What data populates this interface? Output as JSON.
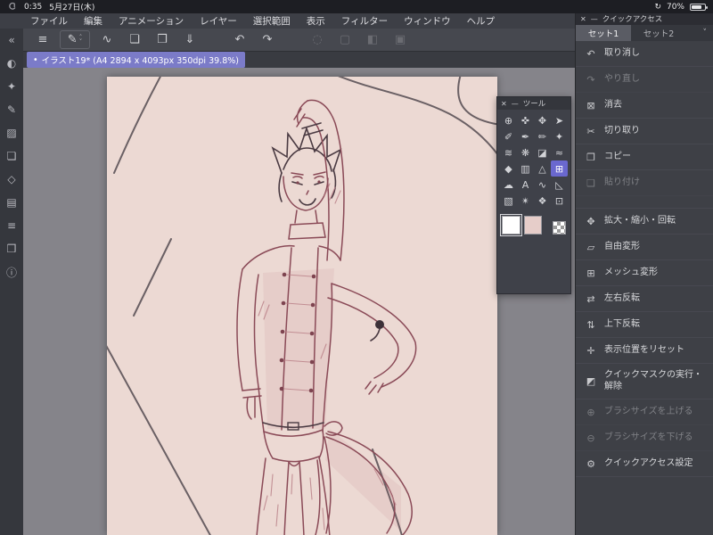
{
  "colors": {
    "app_bg": "#3d3f46",
    "canvas_surround": "#85848a",
    "paper": "#ecd9d3",
    "doc_tab_highlight": "#7b7bc8",
    "selected_tool": "#6a68cf",
    "active_toolbar_button": "#4d6096"
  },
  "status_bar": {
    "time": "0:35",
    "date": "5月27日(木)",
    "orientation_icon": "↻",
    "battery_percent": "70%"
  },
  "menu_bar": {
    "items": [
      "ファイル",
      "編集",
      "アニメーション",
      "レイヤー",
      "選択範囲",
      "表示",
      "フィルター",
      "ウィンドウ",
      "ヘルプ"
    ]
  },
  "toolbar": {
    "chevron_up": "˄",
    "chevron_down": "˅",
    "buttons": [
      {
        "name": "main-menu",
        "glyph": "≡"
      },
      {
        "name": "tool-property",
        "glyph": "✎"
      },
      {
        "name": "curve-tool",
        "glyph": "∿"
      },
      {
        "name": "new-canvas",
        "glyph": "❏"
      },
      {
        "name": "open-file",
        "glyph": "❒"
      },
      {
        "name": "export",
        "glyph": "⇓"
      },
      {
        "name": "undo",
        "glyph": "↶"
      },
      {
        "name": "redo",
        "glyph": "↷"
      },
      {
        "name": "selection-launcher",
        "glyph": "◌",
        "disabled": true
      },
      {
        "name": "deselect",
        "glyph": "▢",
        "disabled": true
      },
      {
        "name": "invert-selection",
        "glyph": "◧",
        "disabled": true
      },
      {
        "name": "fill-selection",
        "glyph": "▣",
        "disabled": true
      },
      {
        "name": "pen-mode",
        "glyph": "✒",
        "active": true
      },
      {
        "name": "brush-mode",
        "glyph": "✐",
        "active": true
      },
      {
        "name": "edit-pencil",
        "glyph": "✏"
      }
    ]
  },
  "doc_bar": {
    "indicator": "•",
    "tab_label": "イラスト19* (A4 2894 x 4093px 350dpi 39.8%)",
    "highlight": "#7b7bc8"
  },
  "sidebar": {
    "icons": [
      {
        "name": "collapse",
        "glyph": "«"
      },
      {
        "name": "color-circle",
        "glyph": "◐"
      },
      {
        "name": "color-set",
        "glyph": "✦"
      },
      {
        "name": "pen-settings",
        "glyph": "✎"
      },
      {
        "name": "material",
        "glyph": "▨"
      },
      {
        "name": "layers",
        "glyph": "❏"
      },
      {
        "name": "3d-material",
        "glyph": "◇"
      },
      {
        "name": "navigator",
        "glyph": "▤"
      },
      {
        "name": "item-list",
        "glyph": "≡"
      },
      {
        "name": "subview",
        "glyph": "❒"
      },
      {
        "name": "information",
        "glyph": "ⓘ"
      }
    ]
  },
  "tool_palette": {
    "close_glyph": "✕",
    "minimize_glyph": "—",
    "title": "ツール",
    "selected_color": "#6a68cf",
    "tools": [
      {
        "name": "zoom",
        "glyph": "⊕"
      },
      {
        "name": "hand",
        "glyph": "✜"
      },
      {
        "name": "move",
        "glyph": "✥"
      },
      {
        "name": "object",
        "glyph": "➤"
      },
      {
        "name": "eyedropper",
        "glyph": "✐"
      },
      {
        "name": "pen",
        "glyph": "✒"
      },
      {
        "name": "pencil",
        "glyph": "✏"
      },
      {
        "name": "brush",
        "glyph": "✦"
      },
      {
        "name": "airbrush",
        "glyph": "≋"
      },
      {
        "name": "decoration",
        "glyph": "❋"
      },
      {
        "name": "eraser",
        "glyph": "◪"
      },
      {
        "name": "blend",
        "glyph": "≈"
      },
      {
        "name": "fill",
        "glyph": "◆"
      },
      {
        "name": "gradient",
        "glyph": "▥"
      },
      {
        "name": "figure",
        "glyph": "△"
      },
      {
        "name": "frame-border",
        "glyph": "⊞",
        "selected": true
      },
      {
        "name": "balloon",
        "glyph": "☁"
      },
      {
        "name": "text",
        "glyph": "A"
      },
      {
        "name": "line-correction",
        "glyph": "∿"
      },
      {
        "name": "ruler",
        "glyph": "◺"
      },
      {
        "name": "selection",
        "glyph": "▧"
      },
      {
        "name": "auto-select",
        "glyph": "✴"
      },
      {
        "name": "operation",
        "glyph": "❖"
      },
      {
        "name": "subview-tool",
        "glyph": "⊡"
      }
    ],
    "main_color": "#ffffff",
    "sub_color": "#e6cdc9"
  },
  "quick_access": {
    "close_glyph": "✕",
    "minimize_glyph": "—",
    "title": "クイックアクセス",
    "collapse_glyph": "˅",
    "tabs": [
      {
        "label": "セット1",
        "active": true
      },
      {
        "label": "セット2",
        "active": false
      }
    ],
    "items": [
      {
        "label": "取り消し",
        "glyph": "↶",
        "enabled": true
      },
      {
        "label": "やり直し",
        "glyph": "↷",
        "enabled": false
      },
      {
        "label": "消去",
        "glyph": "⊠",
        "enabled": true
      },
      {
        "label": "切り取り",
        "glyph": "✂",
        "enabled": true
      },
      {
        "label": "コピー",
        "glyph": "❐",
        "enabled": true
      },
      {
        "label": "貼り付け",
        "glyph": "❑",
        "enabled": false
      },
      {
        "label": "拡大・縮小・回転",
        "glyph": "✥",
        "enabled": true
      },
      {
        "label": "自由変形",
        "glyph": "▱",
        "enabled": true
      },
      {
        "label": "メッシュ変形",
        "glyph": "⊞",
        "enabled": true
      },
      {
        "label": "左右反転",
        "glyph": "⇄",
        "enabled": true
      },
      {
        "label": "上下反転",
        "glyph": "⇅",
        "enabled": true
      },
      {
        "label": "表示位置をリセット",
        "glyph": "✛",
        "enabled": true
      },
      {
        "label": "クイックマスクの実行・解除",
        "glyph": "◩",
        "enabled": true
      },
      {
        "label": "ブラシサイズを上げる",
        "glyph": "⊕",
        "enabled": false
      },
      {
        "label": "ブラシサイズを下げる",
        "glyph": "⊖",
        "enabled": false
      },
      {
        "label": "クイックアクセス設定",
        "glyph": "⚙",
        "enabled": true
      }
    ]
  }
}
